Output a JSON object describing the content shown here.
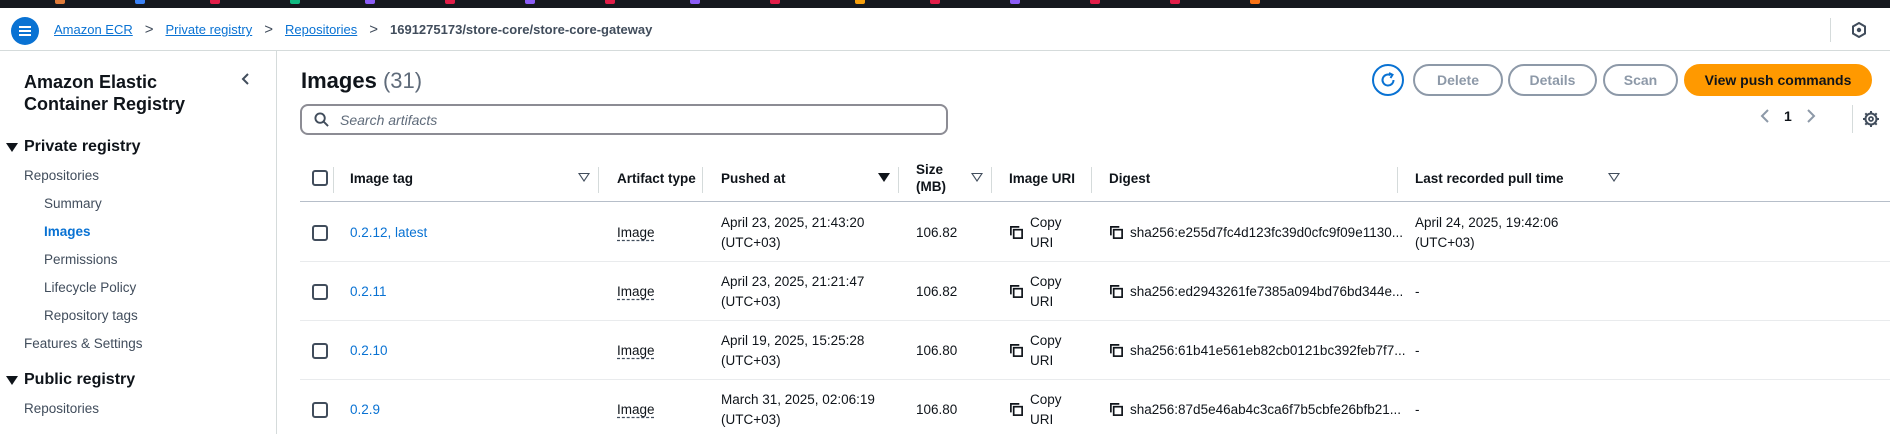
{
  "topbar": {
    "colors": [
      "#e07b39",
      "#3b82f6",
      "#e11d48",
      "#10b981",
      "#8b5cf6",
      "#e11d48",
      "#8b5cf6",
      "#e11d48",
      "#8b5cf6",
      "#e11d48",
      "#f59e0b",
      "#e11d48",
      "#8b5cf6",
      "#e11d48",
      "#e11d48",
      "#f97316"
    ]
  },
  "breadcrumb": {
    "items": [
      "Amazon ECR",
      "Private registry",
      "Repositories"
    ],
    "separator": ">",
    "current": "1691275173/store-core/store-core-gateway"
  },
  "sidebar": {
    "title": "Amazon Elastic Container Registry",
    "private_registry": {
      "label": "Private registry",
      "repositories": "Repositories",
      "sub_items": [
        "Summary",
        "Images",
        "Permissions",
        "Lifecycle Policy",
        "Repository tags"
      ],
      "active": "Images",
      "features": "Features & Settings"
    },
    "public_registry": {
      "label": "Public registry",
      "repositories": "Repositories"
    }
  },
  "main": {
    "title": "Images",
    "count": "(31)",
    "buttons": {
      "delete": "Delete",
      "details": "Details",
      "scan": "Scan",
      "view_push": "View push commands"
    },
    "search_placeholder": "Search artifacts",
    "pagination": {
      "page": "1"
    }
  },
  "table": {
    "columns": [
      "Image tag",
      "Artifact type",
      "Pushed at",
      "Size (MB)",
      "Image URI",
      "Digest",
      "Last recorded pull time"
    ],
    "copy_label": "Copy URI",
    "rows": [
      {
        "tag": "0.2.12, latest",
        "artifact": "Image",
        "pushed": "April 23, 2025, 21:43:20",
        "pushed_tz": "(UTC+03)",
        "size": "106.82",
        "digest": "sha256:e255d7fc4d123fc39d0cfc9f09e1130...",
        "pull": "April 24, 2025, 19:42:06",
        "pull_tz": "(UTC+03)"
      },
      {
        "tag": "0.2.11",
        "artifact": "Image",
        "pushed": "April 23, 2025, 21:21:47",
        "pushed_tz": "(UTC+03)",
        "size": "106.82",
        "digest": "sha256:ed2943261fe7385a094bd76bd344e...",
        "pull": "-",
        "pull_tz": ""
      },
      {
        "tag": "0.2.10",
        "artifact": "Image",
        "pushed": "April 19, 2025, 15:25:28",
        "pushed_tz": "(UTC+03)",
        "size": "106.80",
        "digest": "sha256:61b41e561eb82cb0121bc392feb7f7...",
        "pull": "-",
        "pull_tz": ""
      },
      {
        "tag": "0.2.9",
        "artifact": "Image",
        "pushed": "March 31, 2025, 02:06:19",
        "pushed_tz": "(UTC+03)",
        "size": "106.80",
        "digest": "sha256:87d5e46ab4c3ca6f7b5cbfe26bfb21...",
        "pull": "-",
        "pull_tz": ""
      }
    ]
  }
}
